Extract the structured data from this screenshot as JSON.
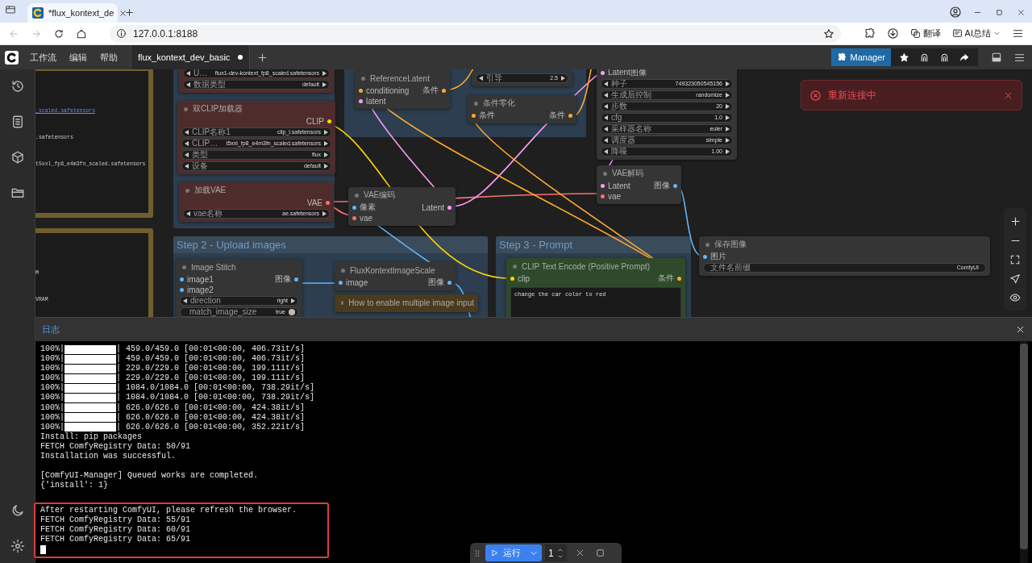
{
  "browser": {
    "tab_title": "*flux_kontext_de",
    "url": "127.0.0.1:8188",
    "toolbar_buttons": [
      "翻译",
      "AI总结"
    ]
  },
  "menu_bar": {
    "menus": [
      "工作流",
      "编辑",
      "帮助"
    ],
    "workflow_tab": {
      "title": "flux_kontext_dev_basic",
      "unsaved": true
    },
    "manager_button": "Manager"
  },
  "canvas": {
    "groups": [
      {
        "color": "#6f5f2f",
        "lines": [
          {
            "kind": "link",
            "text": "_scaled.safetensors"
          },
          {
            "kind": "plain",
            "text": ".safetensors"
          },
          {
            "kind": "plain",
            "text": "t5xxl_fp8_e4m3fn_scaled.safetensors"
          }
        ]
      },
      {
        "color": "#6f5f2f",
        "lines": [
          {
            "kind": "plain",
            "text": "M"
          },
          {
            "kind": "plain",
            "text": "VRAM"
          }
        ]
      },
      {
        "color": "#2c3e4f"
      },
      {
        "color": "#2c3e4f"
      },
      {
        "color": "#2c3e4f",
        "title": "Step 2 - Upload images"
      },
      {
        "color": "#2c3e4f",
        "title": "Step 3 - Prompt"
      }
    ],
    "nodes": [
      {
        "color": "#4f2c2c",
        "widgets": [
          {
            "kind": "arrows",
            "label": "U…",
            "value": "flux1-dev-kontext_fp8_scaled.safetensors"
          },
          {
            "kind": "arrows",
            "label": "数据类型",
            "value": "default"
          }
        ]
      },
      {
        "title": "双CLIP加载器",
        "color": "#4f2c2c",
        "outputs": [
          {
            "name": "CLIP",
            "color": "#ffd500"
          }
        ],
        "widgets": [
          {
            "kind": "arrows",
            "label": "CLIP名称1",
            "value": "clip_l.safetensors"
          },
          {
            "kind": "arrows",
            "label": "CLIP…",
            "value": "t5xxl_fp8_e4m3fn_scaled.safetensors"
          },
          {
            "kind": "arrows",
            "label": "类型",
            "value": "flux"
          },
          {
            "kind": "arrows",
            "label": "设备",
            "value": "default"
          }
        ]
      },
      {
        "title": "加载VAE",
        "color": "#4f2c2c",
        "outputs": [
          {
            "name": "VAE",
            "color": "#ff6e6e"
          }
        ],
        "widgets": [
          {
            "kind": "arrows",
            "label": "vae名称",
            "value": "ae.safetensors"
          }
        ]
      },
      {
        "title": "ReferenceLatent",
        "color": "#353535",
        "inputs": [
          {
            "name": "conditioning",
            "color": "#ffa931"
          },
          {
            "name": "latent",
            "color": "#ff9cf9"
          }
        ],
        "outputs": [
          {
            "name": "条件",
            "color": "#ffa931"
          }
        ]
      },
      {
        "color": "#353535",
        "widgets": [
          {
            "kind": "arrows",
            "label": "引导",
            "value": "2.5"
          }
        ]
      },
      {
        "title": "条件零化",
        "color": "#353535",
        "inputs": [
          {
            "name": "条件",
            "color": "#ffa931"
          }
        ],
        "outputs": [
          {
            "name": "条件",
            "color": "#ffa931"
          }
        ]
      },
      {
        "color": "#353535",
        "inputs": [
          {
            "name": "Latent图像",
            "color": "#ff9cf9"
          }
        ],
        "widgets": [
          {
            "kind": "arrows",
            "label": "种子",
            "value": "749323050545156"
          },
          {
            "kind": "arrows",
            "label": "生成后控制",
            "value": "randomize"
          },
          {
            "kind": "arrows",
            "label": "步数",
            "value": "20"
          },
          {
            "kind": "arrows",
            "label": "cfg",
            "value": "1.0"
          },
          {
            "kind": "arrows",
            "label": "采样器名称",
            "value": "euler"
          },
          {
            "kind": "arrows",
            "label": "调度器",
            "value": "simple"
          },
          {
            "kind": "arrows",
            "label": "降噪",
            "value": "1.00"
          }
        ]
      },
      {
        "title": "VAE解码",
        "color": "#353535",
        "inputs": [
          {
            "name": "Latent",
            "color": "#ff9cf9"
          },
          {
            "name": "vae",
            "color": "#ff6e6e"
          }
        ],
        "outputs": [
          {
            "name": "图像",
            "color": "#64b5f6"
          }
        ]
      },
      {
        "title": "VAE编码",
        "color": "#353535",
        "inputs": [
          {
            "name": "像素",
            "color": "#64b5f6"
          },
          {
            "name": "vae",
            "color": "#ff6e6e"
          }
        ],
        "outputs": [
          {
            "name": "Latent",
            "color": "#ff9cf9"
          }
        ]
      },
      {
        "title": "Image Stitch",
        "color": "#353535",
        "inputs": [
          {
            "name": "image1",
            "color": "#64b5f6"
          },
          {
            "name": "image2",
            "color": "#64b5f6"
          }
        ],
        "outputs": [
          {
            "name": "图像",
            "color": "#64b5f6"
          }
        ],
        "widgets": [
          {
            "kind": "arrows",
            "label": "direction",
            "value": "right"
          },
          {
            "kind": "toggle",
            "label": "match_image_size",
            "value": "true",
            "on": true
          }
        ]
      },
      {
        "title": "FluxKontextImageScale",
        "color": "#353535",
        "inputs": [
          {
            "name": "image",
            "color": "#64b5f6"
          }
        ],
        "outputs": [
          {
            "name": "图像",
            "color": "#64b5f6"
          }
        ]
      },
      {
        "title": "How to enable multiple image input",
        "color": "#4a3a1e"
      },
      {
        "title": "CLIP Text Encode (Positive Prompt)",
        "color": "#2e4a2a",
        "inputs": [
          {
            "name": "clip",
            "color": "#ffd500"
          }
        ],
        "outputs": [
          {
            "name": "条件",
            "color": "#ffa931"
          }
        ],
        "widgets": [
          {
            "kind": "text",
            "value": "change the car color to red"
          }
        ]
      },
      {
        "title": "保存图像",
        "color": "#353535",
        "inputs": [
          {
            "name": "图片",
            "color": "#64b5f6"
          }
        ],
        "widgets": [
          {
            "kind": "field",
            "label": "文件名前缀",
            "value": "ComfyUI"
          }
        ]
      }
    ],
    "toast": {
      "message": "重新连接中"
    }
  },
  "log": {
    "title": "日志",
    "lines": [
      {
        "kind": "progress",
        "percent": "100%|",
        "level": 1,
        "detail": "| 459.0/459.0 [00:01<00:00, 406.73it/s]"
      },
      {
        "kind": "progress",
        "percent": "100%|",
        "level": 1,
        "detail": "| 459.0/459.0 [00:01<00:00, 406.73it/s]"
      },
      {
        "kind": "progress",
        "percent": "100%|",
        "level": 1,
        "detail": "| 229.0/229.0 [00:01<00:00, 199.11it/s]"
      },
      {
        "kind": "progress",
        "percent": "100%|",
        "level": 1,
        "detail": "| 229.0/229.0 [00:01<00:00, 199.11it/s]"
      },
      {
        "kind": "progress",
        "percent": "100%|",
        "level": 1,
        "detail": "| 1084.0/1084.0 [00:01<00:00, 738.29it/s]"
      },
      {
        "kind": "progress",
        "percent": "100%|",
        "level": 1,
        "detail": "| 1084.0/1084.0 [00:01<00:00, 738.29it/s]"
      },
      {
        "kind": "progress",
        "percent": "100%|",
        "level": 1,
        "detail": "| 626.0/626.0 [00:01<00:00, 424.38it/s]"
      },
      {
        "kind": "progress",
        "percent": "100%|",
        "level": 1,
        "detail": "| 626.0/626.0 [00:01<00:00, 424.38it/s]"
      },
      {
        "kind": "progress",
        "percent": "100%|",
        "level": 1,
        "detail": "| 626.0/626.0 [00:01<00:00, 352.22it/s]"
      },
      {
        "kind": "text",
        "text": "Install: pip packages"
      },
      {
        "kind": "text",
        "text": "FETCH ComfyRegistry Data: 50/91"
      },
      {
        "kind": "text",
        "text": "Installation was successful."
      },
      {
        "kind": "blank"
      },
      {
        "kind": "text",
        "text": "[ComfyUI-Manager] Queued works are completed."
      },
      {
        "kind": "text",
        "text": "{'install': 1}"
      },
      {
        "kind": "blank"
      }
    ],
    "highlighted_lines": [
      "After restarting ComfyUI, please refresh the browser.",
      "FETCH ComfyRegistry Data: 55/91",
      "FETCH ComfyRegistry Data: 60/91",
      "FETCH ComfyRegistry Data: 65/91"
    ]
  },
  "run_bar": {
    "run_label": "运行",
    "batch_count": "1"
  }
}
